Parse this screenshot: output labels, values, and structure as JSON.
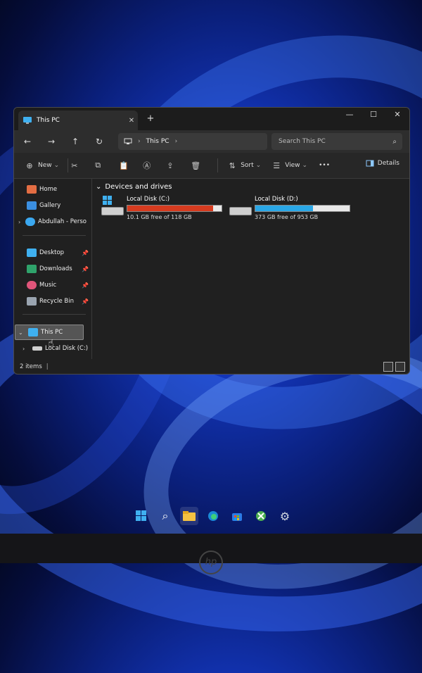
{
  "window": {
    "tab_title": "This PC",
    "new_tab": "+",
    "controls": {
      "minimize": "—",
      "maximize": "☐",
      "close": "✕"
    }
  },
  "address_bar": {
    "nav": {
      "back": "←",
      "forward": "→",
      "up": "↑",
      "refresh": "↻"
    },
    "breadcrumb": [
      "This PC"
    ],
    "search_placeholder": "Search This PC"
  },
  "toolbar": {
    "new_label": "New",
    "sort_label": "Sort",
    "view_label": "View",
    "more_label": "•••",
    "details_label": "Details"
  },
  "sidebar": {
    "items": [
      {
        "label": "Home",
        "icon": "home-icon"
      },
      {
        "label": "Gallery",
        "icon": "gallery-icon"
      },
      {
        "label": "Abdullah - Perso",
        "icon": "onedrive-icon"
      },
      {
        "label": "Desktop",
        "icon": "desktop-icon",
        "pinned": true
      },
      {
        "label": "Downloads",
        "icon": "download-icon",
        "pinned": true
      },
      {
        "label": "Music",
        "icon": "music-icon",
        "pinned": true
      },
      {
        "label": "Recycle Bin",
        "icon": "recycle-bin-icon",
        "pinned": true
      },
      {
        "label": "This PC",
        "icon": "pc-icon",
        "selected": true
      },
      {
        "label": "Local Disk (C:)",
        "icon": "drive-icon"
      }
    ]
  },
  "main": {
    "group_header": "Devices and drives",
    "drives": [
      {
        "name": "Local Disk (C:)",
        "free_text": "10.1 GB free of 118 GB",
        "used_fraction": 0.914,
        "bar_color": "#d63b1f"
      },
      {
        "name": "Local Disk (D:)",
        "free_text": "373 GB free of 953 GB",
        "used_fraction": 0.609,
        "bar_color": "#2aa7e6"
      }
    ]
  },
  "status": {
    "item_count": "2 items"
  },
  "taskbar": [
    "start-icon",
    "search-icon",
    "file-explorer-icon",
    "edge-icon",
    "store-icon",
    "xbox-icon",
    "settings-icon"
  ],
  "colors": {
    "accent": "#2aa7e6",
    "warning": "#d63b1f",
    "window_bg": "#202020"
  }
}
